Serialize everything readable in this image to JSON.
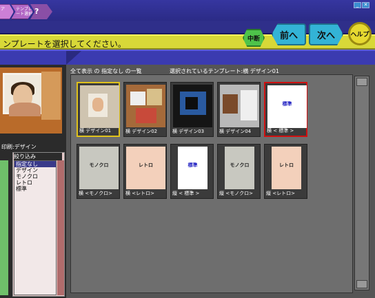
{
  "tabs": {
    "tab1_label": "ア",
    "tab2_label": "テンプレート選択",
    "tab3_label": "?"
  },
  "window": {
    "buttons": [
      "_",
      "✕"
    ]
  },
  "instruction": "ンプレートを選択してください。",
  "buttons": {
    "chudan": "中断",
    "prev": "前へ",
    "next": "次へ",
    "help": "ヘルプ"
  },
  "left": {
    "title": "印刷:デザイン",
    "filter_header": "絞り込み",
    "filters": [
      "指定なし",
      "デザイン",
      "モノクロ",
      "レトロ",
      "標準"
    ]
  },
  "main": {
    "header_left": "全て表示 の 指定なし の一覧",
    "header_right": "選択されているテンプレート:横 デザイン01"
  },
  "cards": [
    {
      "label": "横 デザイン01",
      "caption": ""
    },
    {
      "label": "横 デザイン02",
      "caption": ""
    },
    {
      "label": "横 デザイン03",
      "caption": ""
    },
    {
      "label": "横 デザイン04",
      "caption": ""
    },
    {
      "label": "横 < 標準 >",
      "caption": "標準"
    },
    {
      "label": "横 <モノクロ>",
      "caption": "モノクロ"
    },
    {
      "label": "横 <レトロ>",
      "caption": "レトロ"
    },
    {
      "label": "縦 < 標準 >",
      "caption": "標準"
    },
    {
      "label": "縦 <モノクロ>",
      "caption": "モノクロ"
    },
    {
      "label": "縦 <レトロ>",
      "caption": "レトロ"
    }
  ]
}
